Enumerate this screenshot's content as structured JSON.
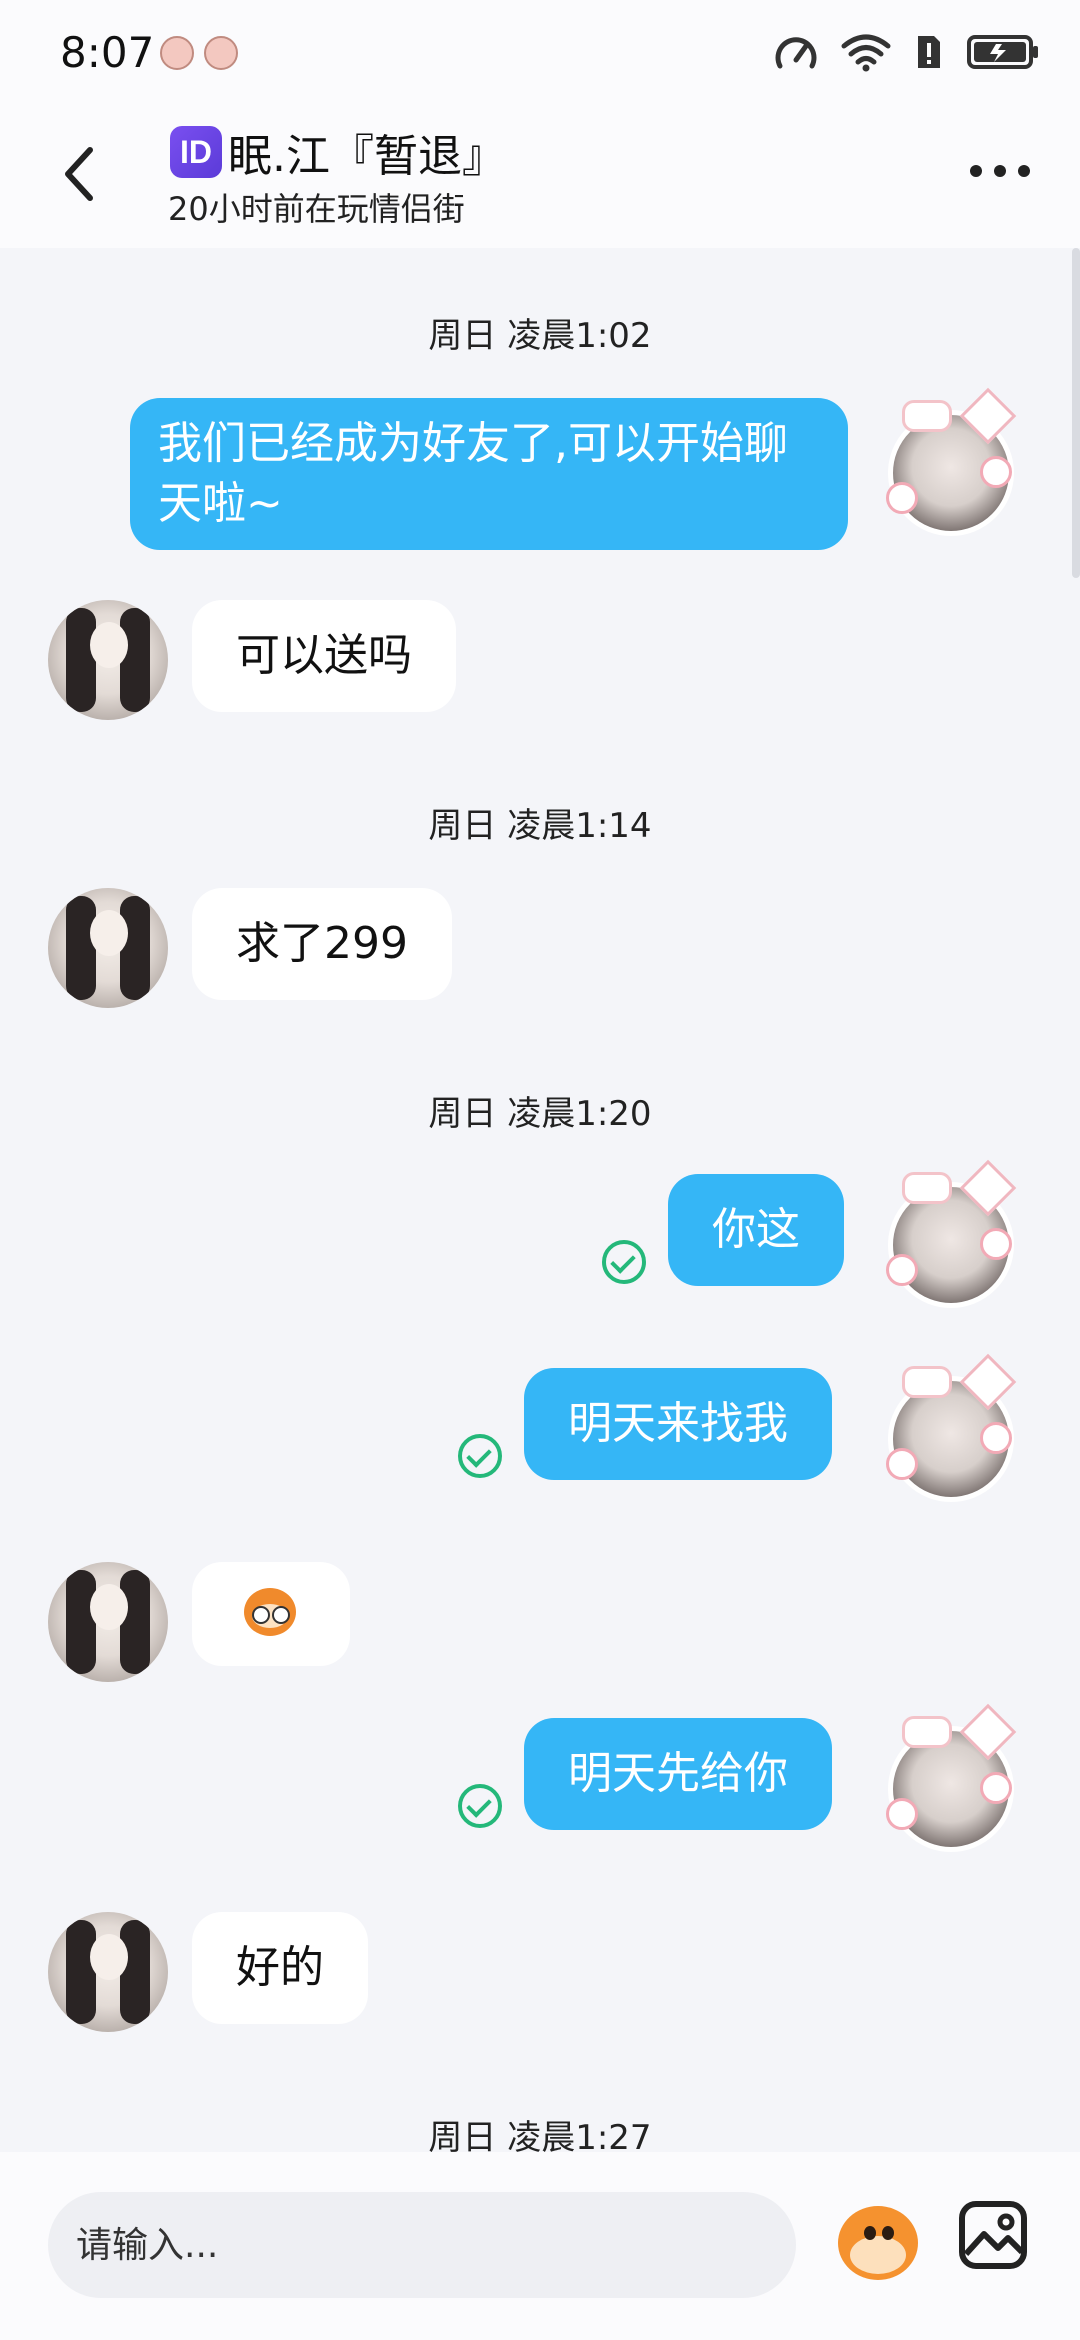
{
  "status_bar": {
    "time": "8:07",
    "icons": [
      "pig-emoji-icon",
      "pig-emoji-icon",
      "speed-icon",
      "wifi-icon",
      "sim-alert-icon",
      "battery-charging-icon"
    ]
  },
  "header": {
    "badge": "ID",
    "name": "眠.江『暂退』",
    "status": "20小时前在玩情侣街"
  },
  "chat": {
    "timestamps": [
      "周日 凌晨1:02",
      "周日 凌晨1:14",
      "周日 凌晨1:20",
      "周日 凌晨1:27"
    ],
    "messages": [
      {
        "side": "sent",
        "text": "我们已经成为好友了,可以开始聊天啦~"
      },
      {
        "side": "received",
        "text": "可以送吗"
      },
      {
        "side": "received",
        "text": "求了299"
      },
      {
        "side": "sent",
        "text": "你这",
        "status": "read"
      },
      {
        "side": "sent",
        "text": "明天来找我",
        "status": "read"
      },
      {
        "side": "received",
        "sticker": "monkey-sticker-icon"
      },
      {
        "side": "sent",
        "text": "明天先给你",
        "status": "read"
      },
      {
        "side": "received",
        "text": "好的"
      }
    ]
  },
  "input": {
    "placeholder": "请输入..."
  },
  "colors": {
    "sent_bubble": "#35b6f6",
    "received_bubble": "#ffffff",
    "chat_background": "#f4f5f9",
    "read_check": "#24b87a",
    "id_badge": "#6a46e6"
  }
}
